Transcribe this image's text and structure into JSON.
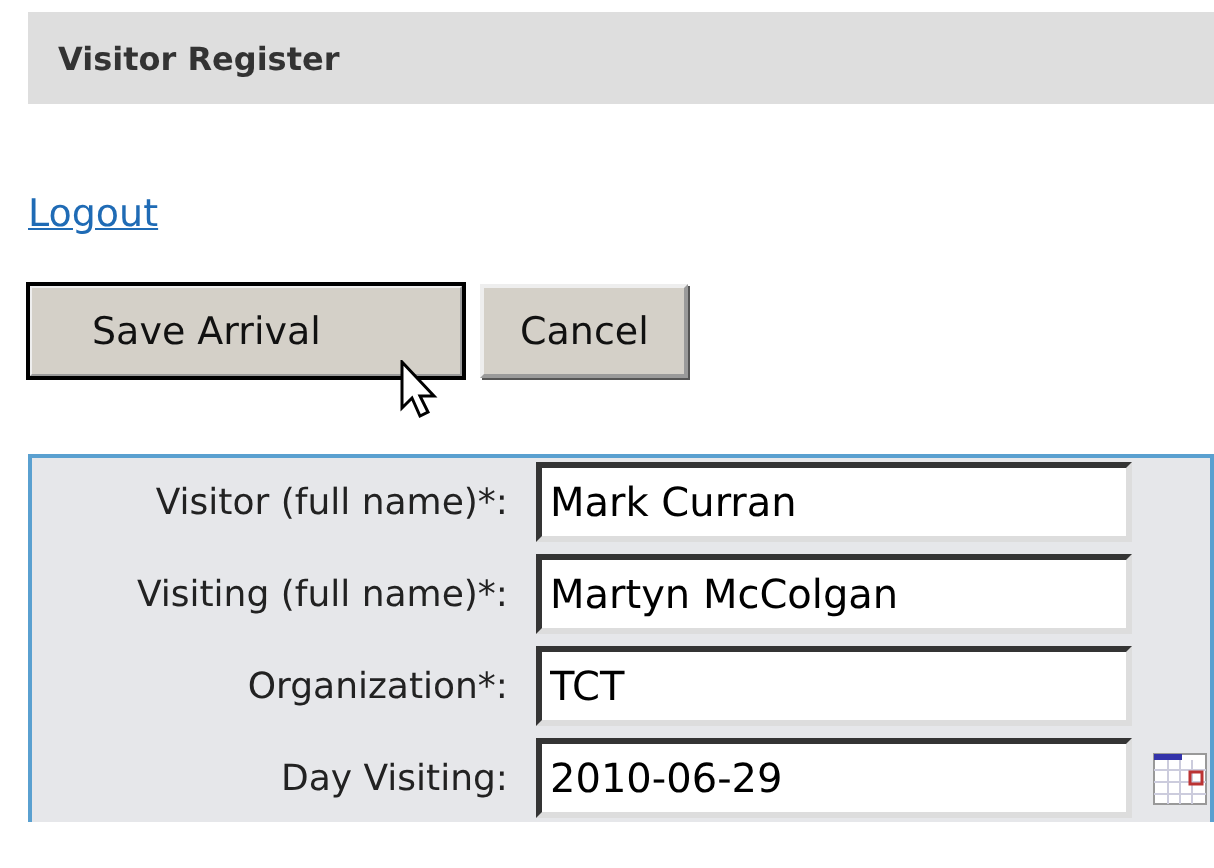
{
  "header": {
    "title": "Visitor Register"
  },
  "logout_link": "Logout",
  "buttons": [
    {
      "label": "Save Arrival",
      "default": true
    },
    {
      "label": "Cancel",
      "default": false
    }
  ],
  "form": {
    "fields": [
      {
        "kind": "text",
        "label": "Visitor (full name)*:",
        "value": "Mark Curran"
      },
      {
        "kind": "text",
        "label": "Visiting (full name)*:",
        "value": "Martyn McColgan"
      },
      {
        "kind": "text",
        "label": "Organization*:",
        "value": "TCT"
      },
      {
        "kind": "date",
        "label": "Day Visiting:",
        "value": "2010-06-29"
      }
    ]
  }
}
